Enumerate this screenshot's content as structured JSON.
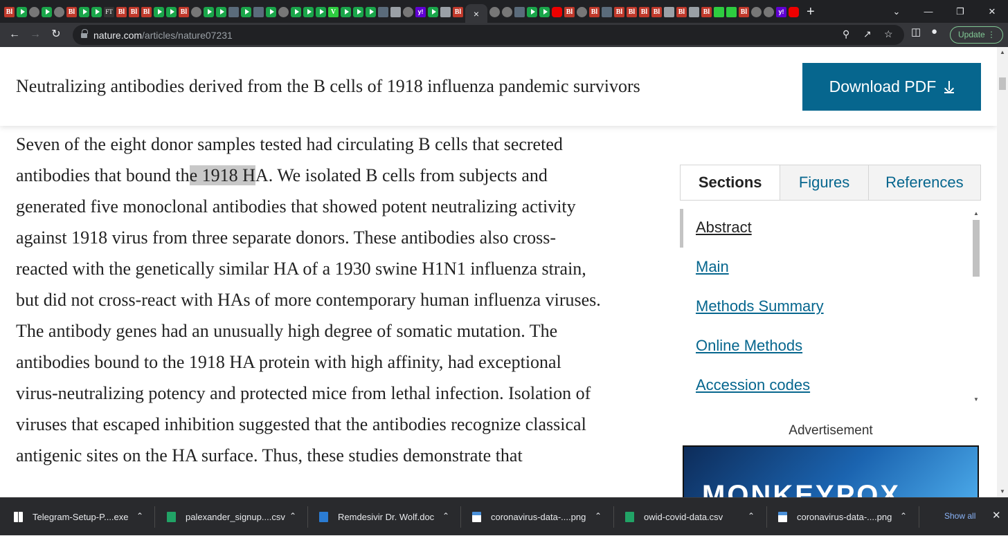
{
  "browser": {
    "tab_favicons": [
      "BI",
      "play",
      "dark",
      "play",
      "dark",
      "BI",
      "play",
      "play",
      "FT",
      "BI",
      "BI",
      "BI",
      "play",
      "play",
      "BI",
      "dark",
      "play",
      "play",
      "arrow",
      "play",
      "arrow",
      "play",
      "dark",
      "play",
      "play",
      "play",
      "V",
      "play",
      "play",
      "play",
      "arrow",
      "gray",
      "dark",
      "yahoo",
      "play",
      "gray",
      "BI"
    ],
    "tab_favicons_after": [
      "dark",
      "dark",
      "arrow",
      "play",
      "play",
      "yt",
      "BI",
      "dark",
      "BI",
      "arrow",
      "BI",
      "BI",
      "BI",
      "BI",
      "gray",
      "BI",
      "gray",
      "BI",
      "green",
      "green",
      "BI",
      "dark",
      "dark",
      "yahoo",
      "yt"
    ],
    "active_tab_close": "×",
    "new_tab": "+",
    "window_controls": {
      "dropdown": "⌄",
      "minimize": "—",
      "restore": "❐",
      "close": "✕"
    },
    "url_host": "nature.com",
    "url_path": "/articles/nature07231",
    "update_label": "Update"
  },
  "article": {
    "title": "Neutralizing antibodies derived from the B cells of 1918 influenza pandemic survivors",
    "download_pdf": "Download PDF",
    "abstract_before": "Seven of the eight donor samples tested had circulating B cells that secreted antibodies that bound th",
    "abstract_highlight": "e 1918 H",
    "abstract_after": "A. We isolated B cells from subjects and generated five monoclonal antibodies that showed potent neutralizing activity against 1918 virus from three separate donors. These antibodies also cross-reacted with the genetically similar HA of a 1930 swine H1N1 influenza strain, but did not cross-react with HAs of more contemporary human influenza viruses. The antibody genes had an unusually high degree of somatic mutation. The antibodies bound to the 1918 HA protein with high affinity, had exceptional virus-neutralizing potency and protected mice from lethal infection. Isolation of viruses that escaped inhibition suggested that the antibodies recognize classical antigenic sites on the HA surface. Thus, these studies demonstrate that"
  },
  "sidebar": {
    "tabs": [
      {
        "label": "Sections",
        "active": true
      },
      {
        "label": "Figures",
        "active": false
      },
      {
        "label": "References",
        "active": false
      }
    ],
    "sections": [
      "Abstract",
      "Main",
      "Methods Summary",
      "Online Methods",
      "Accession codes"
    ],
    "current_section": "Abstract",
    "advert_label": "Advertisement",
    "ad_text": "MONKEYPOX"
  },
  "downloads": {
    "items": [
      {
        "name": "Telegram-Setup-P....exe",
        "icon": "windows-exe-icon",
        "color": "#ffffff"
      },
      {
        "name": "palexander_signup....csv",
        "icon": "excel-csv-icon",
        "color": "#21a366"
      },
      {
        "name": "Remdesivir Dr. Wolf.doc",
        "icon": "word-doc-icon",
        "color": "#2b7cd3"
      },
      {
        "name": "coronavirus-data-....png",
        "icon": "image-file-icon",
        "color": "#4a90d9"
      },
      {
        "name": "owid-covid-data.csv",
        "icon": "excel-csv-icon",
        "color": "#21a366"
      },
      {
        "name": "coronavirus-data-....png",
        "icon": "image-file-icon",
        "color": "#4a90d9"
      }
    ],
    "show_all": "Show all",
    "close": "✕"
  },
  "colors": {
    "link": "#06668e",
    "pdf_button": "#06668e",
    "chrome_dark": "#202124",
    "update_green": "#81c995"
  }
}
